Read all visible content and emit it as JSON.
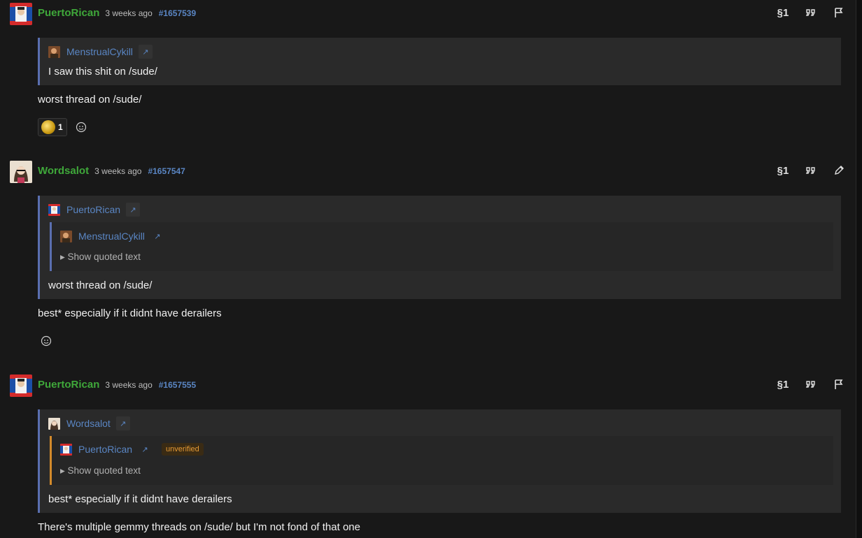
{
  "posts": [
    {
      "username": "PuertoRican",
      "time": "3 weeks ago",
      "id": "#1657539",
      "quote": {
        "author": "MenstrualCykill",
        "link_icon": "↗",
        "text": "I saw this shit on /sude/"
      },
      "body": "worst thread on /sude/",
      "reactions": [
        {
          "icon": "coin-icon",
          "count": "1"
        }
      ],
      "actions": [
        "reply-icon",
        "quote-icon",
        "flag-icon"
      ]
    },
    {
      "username": "Wordsalot",
      "time": "3 weeks ago",
      "id": "#1657547",
      "quote": {
        "author": "PuertoRican",
        "link_icon": "↗",
        "inner": {
          "author": "MenstrualCykill",
          "link_icon": "↗",
          "show_text": "▸ Show quoted text"
        },
        "text": "worst thread on /sude/"
      },
      "body": "best* especially if it didnt have derailers",
      "actions": [
        "reply-icon",
        "quote-icon",
        "edit-icon"
      ]
    },
    {
      "username": "PuertoRican",
      "time": "3 weeks ago",
      "id": "#1657555",
      "quote": {
        "author": "Wordsalot",
        "link_icon": "↗",
        "inner": {
          "author": "PuertoRican",
          "link_icon": "↗",
          "badge": "unverified",
          "show_text": "▸ Show quoted text"
        },
        "text": "best* especially if it didnt have derailers"
      },
      "body": "There's multiple gemmy threads on /sude/ but I'm not fond of that one",
      "actions": [
        "reply-icon",
        "quote-icon",
        "flag-icon"
      ]
    }
  ],
  "colors": {
    "background": "#181818",
    "username": "#3fa83a",
    "link": "#5a86c4",
    "quote_border": "#5a6fb0",
    "warn_border": "#d38a2b"
  }
}
